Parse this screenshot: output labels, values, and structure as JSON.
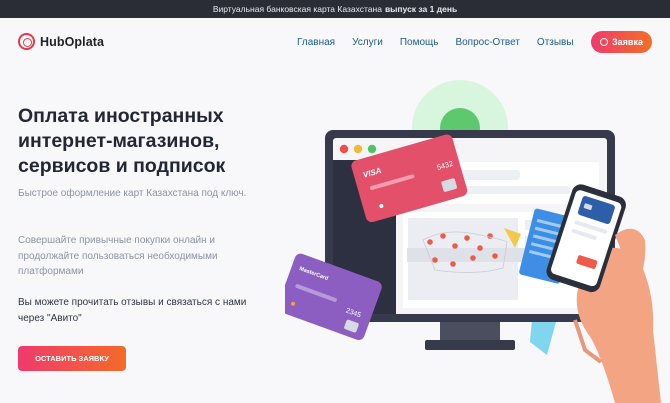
{
  "topbar": {
    "text": "Виртуальная банковская карта Казахстана",
    "emphasis": "выпуск за 1 день"
  },
  "header": {
    "logo_text": "HubOplata",
    "nav": [
      "Главная",
      "Услуги",
      "Помощь",
      "Вопрос-Ответ",
      "Отзывы"
    ],
    "cta_label": "Заявка"
  },
  "hero": {
    "title_lines": [
      "Оплата иностранных",
      "интернет-магазинов,",
      "сервисов и подписок"
    ],
    "paragraph1": "Быстрое оформление карт Казахстана под ключ.",
    "paragraph2": "Совершайте привычные покупки онлайн и продолжайте пользоваться необходимыми платформами",
    "paragraph3": "Вы можете прочитать отзывы и связаться с нами через \"Авито\"",
    "cta_label": "ОСТАВИТЬ ЗАЯВКУ"
  },
  "illustration": {
    "visa_brand": "VISA",
    "visa_digits": "5432",
    "mastercard_brand": "MasterCard",
    "mastercard_digits": "2345"
  },
  "colors": {
    "accent_start": "#f03a6d",
    "accent_end": "#f36f25",
    "topbar_bg": "#2a2d35",
    "nav_text": "#1c5d8a"
  }
}
